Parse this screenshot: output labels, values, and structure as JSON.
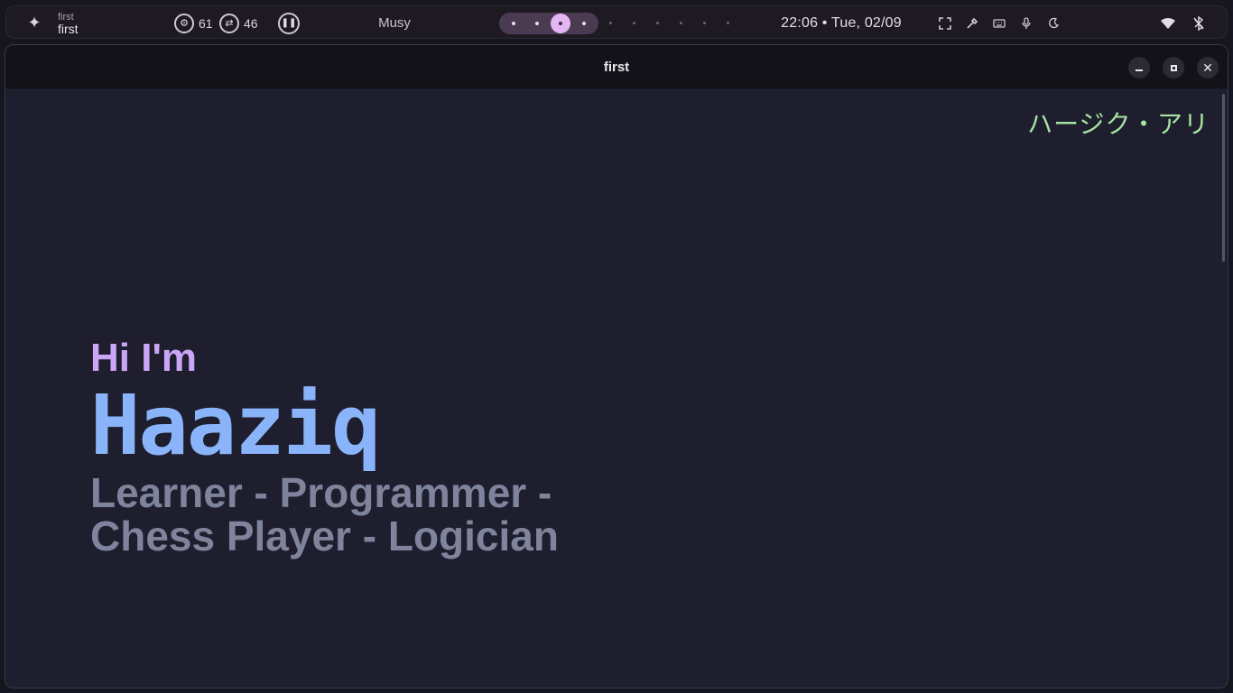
{
  "topbar": {
    "launcher_icon": "sparkle-icon",
    "active_window": {
      "class": "first",
      "title": "first"
    },
    "resources": {
      "cpu": {
        "icon": "cpu-icon",
        "value": "61"
      },
      "swap": {
        "icon": "swap-icon",
        "value": "46"
      }
    },
    "media": {
      "state_icon": "pause-icon",
      "title": "Musy"
    },
    "workspaces": {
      "count": 10,
      "occupied": [
        1,
        2,
        3,
        4
      ],
      "active": 3
    },
    "clock": "22:06 • Tue, 02/09",
    "utilities": [
      "screenshot-region-icon",
      "color-picker-icon",
      "keyboard-icon",
      "microphone-icon",
      "night-light-icon"
    ],
    "system": [
      "wifi-icon",
      "bluetooth-off-icon"
    ]
  },
  "window": {
    "title": "first",
    "controls": [
      "minimize-icon",
      "maximize-icon",
      "close-icon"
    ]
  },
  "page": {
    "japanese_name": "ハージク・アリ",
    "greeting": "Hi I'm",
    "name": "Haaziq",
    "tagline": "Learner - Programmer - Chess Player - Logician"
  },
  "colors": {
    "greeting": "#cba6f7",
    "name": "#89b4fa",
    "tagline": "#7f849c",
    "japanese_name": "#a6e3a1",
    "background": "#1e1e2e",
    "workspace_active": "#e6b6f4"
  }
}
